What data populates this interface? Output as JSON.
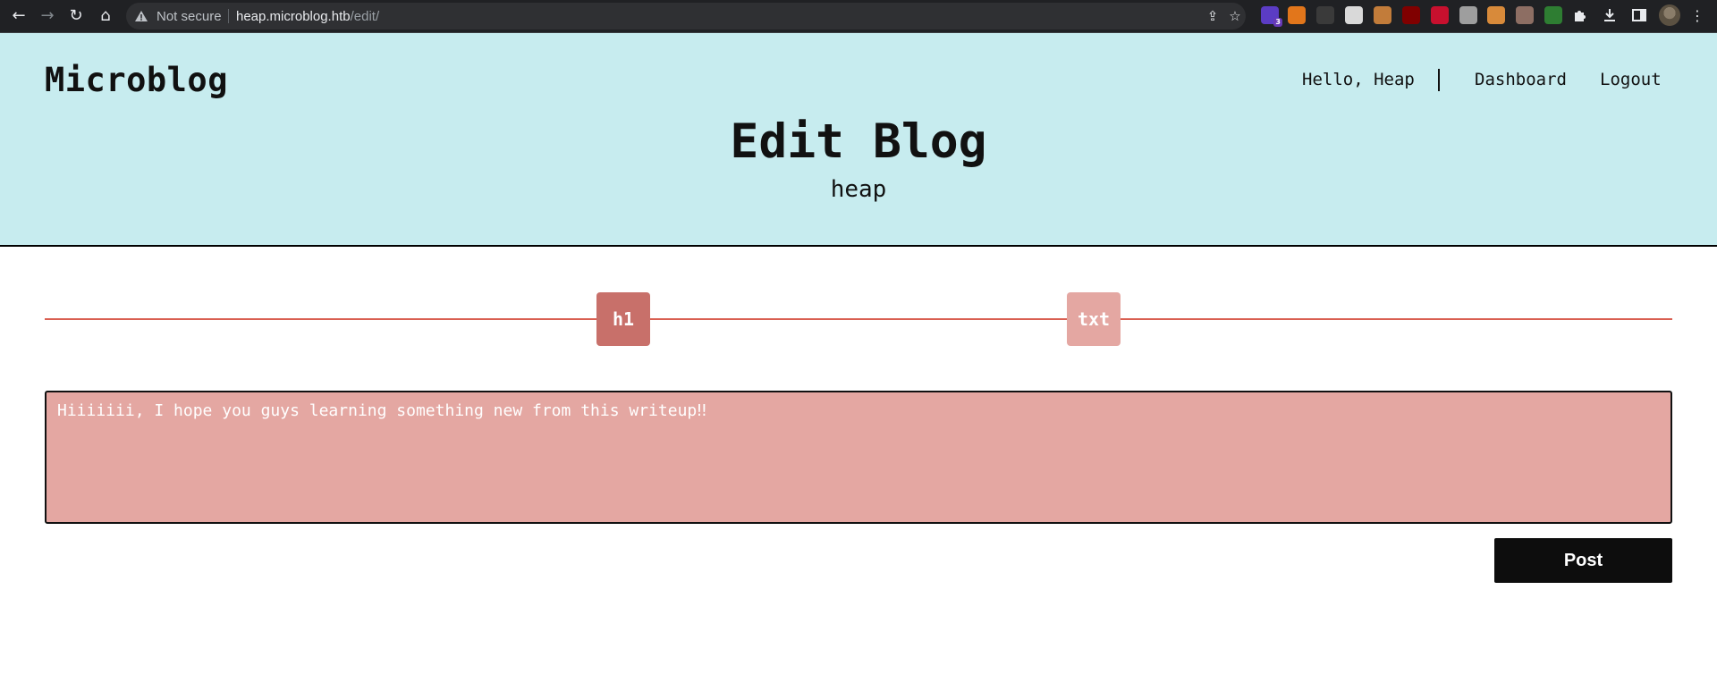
{
  "browser": {
    "security_label": "Not secure",
    "url_host": "heap.microblog.htb",
    "url_path": "/edit/",
    "back_icon": "←",
    "forward_icon": "→",
    "reload_icon": "↻",
    "home_icon": "⌂",
    "share_icon": "⇪",
    "star_icon": "☆",
    "extension_badge": "3",
    "extensions": [
      {
        "name": "ext-1-icon",
        "color": "#5b3cc4"
      },
      {
        "name": "metamask-icon",
        "color": "#e2761b"
      },
      {
        "name": "ext-3-icon",
        "color": "#3a3a3a"
      },
      {
        "name": "ext-4-icon",
        "color": "#d9d9d9"
      },
      {
        "name": "cookie-icon",
        "color": "#c27c3a"
      },
      {
        "name": "ublock-icon",
        "color": "#800000"
      },
      {
        "name": "wappalyzer-icon",
        "color": "#c8102e"
      },
      {
        "name": "ext-8-icon",
        "color": "#9e9e9e"
      },
      {
        "name": "cookie-editor-icon",
        "color": "#d88a3a"
      },
      {
        "name": "ext-10-icon",
        "color": "#8d6e63"
      },
      {
        "name": "ext-11-icon",
        "color": "#2e7d32"
      }
    ],
    "menu_icon": "⋮"
  },
  "header": {
    "brand": "Microblog",
    "greeting": "Hello, Heap",
    "nav": [
      "Dashboard",
      "Logout"
    ],
    "title": "Edit Blog",
    "subtitle": "heap"
  },
  "editor": {
    "tools": [
      "h1",
      "txt"
    ],
    "content": "Hiiiiiii, I hope you guys learning something new from this writeup‼",
    "post_label": "Post"
  },
  "colors": {
    "header_bg": "#c7ecef",
    "accent_line": "#d95f52",
    "tool_h1": "#c8706a",
    "tool_txt": "#e4a7a2",
    "textarea_bg": "#e4a7a2",
    "post_bg": "#0d0d0d"
  }
}
